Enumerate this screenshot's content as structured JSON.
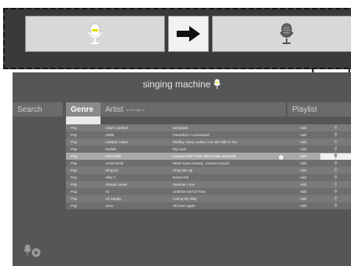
{
  "app": {
    "title": "singing machine"
  },
  "headers": {
    "search": "Search",
    "genre": "Genre",
    "artist": "Artist",
    "artist_sub": "in the style of",
    "song": "",
    "playlist": "Playlist"
  },
  "genre_filter": "",
  "rows": [
    {
      "genre": "Pop",
      "artist": "Adam Lambert",
      "song": "Sexyback",
      "add": "Add"
    },
    {
      "genre": "Pop",
      "artist": "Adele",
      "song": "Futurefies / LoveSound",
      "add": "Add"
    },
    {
      "genre": "Pop",
      "artist": "Adolphe Adam",
      "song": "Medley: Sexy Ladies / Let Me Talk to You",
      "add": "Add"
    },
    {
      "genre": "Pop",
      "artist": "Aeolah",
      "song": "My Love",
      "add": "Add"
    },
    {
      "genre": "Pop",
      "artist": "Aerosmith",
      "song": "LoveSound/I Think She Knows Interlude",
      "add": "Add"
    },
    {
      "genre": "Pop",
      "artist": "Arrow Rock",
      "song": "What Goes Around...Comes Around",
      "add": "Add"
    },
    {
      "genre": "Pop",
      "artist": "Afrojack",
      "song": "Chop Me Up",
      "add": "Add"
    },
    {
      "genre": "Pop",
      "artist": "After 7",
      "song": "Damn Girl",
      "add": "Add"
    },
    {
      "genre": "Pop",
      "artist": "Ahmad Jamal",
      "song": "Summer Love",
      "add": "Add"
    },
    {
      "genre": "Pop",
      "artist": "Air",
      "song": "Until the End of Time",
      "add": "Add"
    },
    {
      "genre": "Pop",
      "artist": "Air Supply",
      "song": "Losing My Way",
      "add": "Add"
    },
    {
      "genre": "Pop",
      "artist": "Akon",
      "song": "All Over Again",
      "add": "Add"
    }
  ],
  "selected_row": 4,
  "colors": {
    "accent_mic": "#e8e000",
    "panel_bg": "#d8d8d8",
    "app_bg": "#565656"
  },
  "icons": [
    "mic-icon",
    "arrow-right-icon",
    "play-icon"
  ]
}
